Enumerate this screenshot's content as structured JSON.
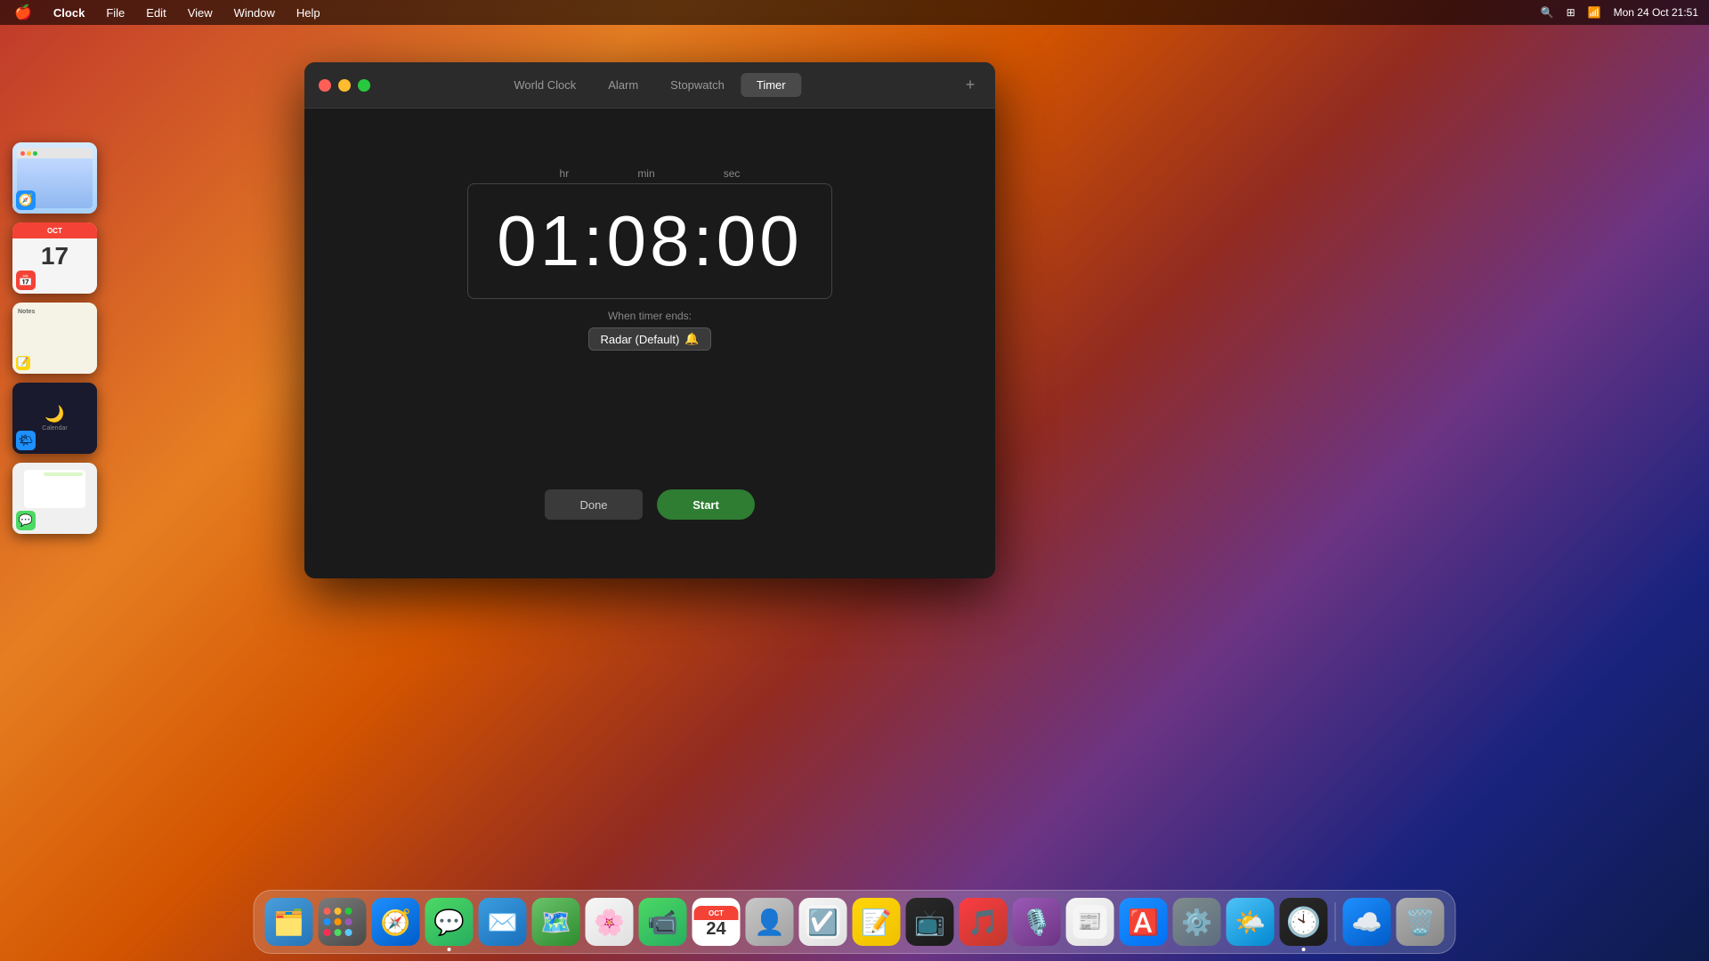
{
  "desktop": {
    "background": "macOS Ventura orange gradient"
  },
  "menubar": {
    "apple": "🍎",
    "app_name": "Clock",
    "menus": [
      "File",
      "Edit",
      "View",
      "Window",
      "Help"
    ],
    "right_items": [
      "search",
      "controlcenter",
      "wifi",
      "datetime"
    ],
    "datetime": "Mon 24 Oct  21:51"
  },
  "app_switcher": {
    "thumbnails": [
      {
        "id": "safari-thumb",
        "type": "safari",
        "icon": "🧭"
      },
      {
        "id": "calendar-thumb",
        "type": "calendar",
        "icon": "📅",
        "date": "17"
      },
      {
        "id": "notes-thumb",
        "type": "notes",
        "icon": "📝"
      },
      {
        "id": "dark-thumb",
        "type": "dark",
        "icon": "🕐"
      },
      {
        "id": "message-thumb",
        "type": "message",
        "icon": "💬"
      }
    ]
  },
  "clock_window": {
    "title": "Clock",
    "tabs": [
      {
        "id": "world-clock",
        "label": "World Clock",
        "active": false
      },
      {
        "id": "alarm",
        "label": "Alarm",
        "active": false
      },
      {
        "id": "stopwatch",
        "label": "Stopwatch",
        "active": false
      },
      {
        "id": "timer",
        "label": "Timer",
        "active": true
      }
    ],
    "add_button": "+",
    "timer": {
      "hr_label": "hr",
      "min_label": "min",
      "sec_label": "sec",
      "time_display": "01:08:00",
      "when_ends_label": "When timer ends:",
      "sound_selector": "Radar (Default)",
      "sound_emoji": "🔔",
      "done_button": "Done",
      "start_button": "Start"
    }
  },
  "dock": {
    "items": [
      {
        "id": "finder",
        "label": "Finder",
        "icon": "🔵",
        "class": "dock-finder",
        "emoji": "🗂",
        "dot": false
      },
      {
        "id": "launchpad",
        "label": "Launchpad",
        "icon": "⊞",
        "class": "dock-launchpad",
        "emoji": "⊞",
        "dot": false
      },
      {
        "id": "safari",
        "label": "Safari",
        "icon": "🧭",
        "class": "dock-safari",
        "emoji": "🧭",
        "dot": false
      },
      {
        "id": "messages",
        "label": "Messages",
        "icon": "💬",
        "class": "dock-messages",
        "emoji": "💬",
        "dot": true
      },
      {
        "id": "mail",
        "label": "Mail",
        "icon": "✉️",
        "class": "dock-mail",
        "emoji": "✉️",
        "dot": false
      },
      {
        "id": "maps",
        "label": "Maps",
        "icon": "🗺",
        "class": "dock-maps",
        "emoji": "🗺",
        "dot": false
      },
      {
        "id": "photos",
        "label": "Photos",
        "icon": "🌸",
        "class": "dock-photos",
        "emoji": "🌸",
        "dot": false
      },
      {
        "id": "facetime",
        "label": "FaceTime",
        "icon": "📹",
        "class": "dock-facetime",
        "emoji": "📹",
        "dot": false
      },
      {
        "id": "calendar",
        "label": "Calendar",
        "icon": "📅",
        "class": "dock-calendar",
        "emoji": "📅",
        "dot": false
      },
      {
        "id": "contacts",
        "label": "Contacts",
        "icon": "👤",
        "class": "dock-contacts",
        "emoji": "👤",
        "dot": false
      },
      {
        "id": "reminders",
        "label": "Reminders",
        "icon": "☑️",
        "class": "dock-reminders",
        "emoji": "☑️",
        "dot": false
      },
      {
        "id": "notes",
        "label": "Notes",
        "icon": "📝",
        "class": "dock-notes",
        "emoji": "📝",
        "dot": false
      },
      {
        "id": "appletv",
        "label": "Apple TV",
        "icon": "📺",
        "class": "dock-appletv",
        "emoji": "📺",
        "dot": false
      },
      {
        "id": "music",
        "label": "Music",
        "icon": "🎵",
        "class": "dock-music",
        "emoji": "🎵",
        "dot": false
      },
      {
        "id": "podcasts",
        "label": "Podcasts",
        "icon": "🎙",
        "class": "dock-podcasts",
        "emoji": "🎙",
        "dot": false
      },
      {
        "id": "news",
        "label": "News",
        "icon": "📰",
        "class": "dock-news",
        "emoji": "📰",
        "dot": false
      },
      {
        "id": "appstore",
        "label": "App Store",
        "icon": "🅰",
        "class": "dock-appstore",
        "emoji": "🅰",
        "dot": false
      },
      {
        "id": "syspreferences",
        "label": "System Preferences",
        "icon": "⚙️",
        "class": "dock-syspreferences",
        "emoji": "⚙️",
        "dot": false
      },
      {
        "id": "weather",
        "label": "Weather",
        "icon": "🌤",
        "class": "dock-weather",
        "emoji": "🌤",
        "dot": false
      },
      {
        "id": "clock",
        "label": "Clock",
        "icon": "🕐",
        "class": "dock-clock",
        "emoji": "🕐",
        "dot": true
      }
    ],
    "sep_items": [
      {
        "id": "airdrop",
        "label": "AirDrop",
        "icon": "☁️",
        "class": "dock-airdrop",
        "emoji": "☁️",
        "dot": false
      },
      {
        "id": "trash",
        "label": "Trash",
        "icon": "🗑",
        "class": "dock-trash",
        "emoji": "🗑",
        "dot": false
      }
    ]
  }
}
